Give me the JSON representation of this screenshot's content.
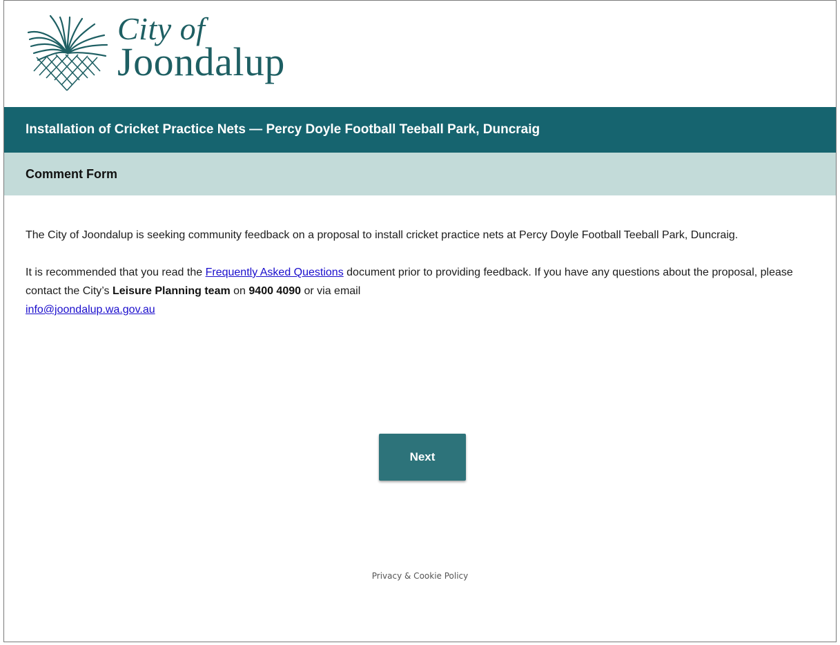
{
  "logo": {
    "icon": "joondalup-palm-lattice-logo",
    "line1": "City of",
    "line2": "Joondalup",
    "color": "#1e5f63"
  },
  "header": {
    "title": "Installation of Cricket Practice Nets — Percy Doyle Football Teeball Park, Duncraig",
    "background": "#16646f"
  },
  "subheader": {
    "title": "Comment Form",
    "background": "#c3dbd9"
  },
  "intro": {
    "paragraph1": "The City of Joondalup is seeking community feedback on a proposal to install cricket practice nets at Percy Doyle Football Teeball Park, Duncraig.",
    "p2_before": "It is recommended that you read the ",
    "faq_link": "Frequently Asked Questions",
    "p2_middle": " document prior to providing feedback. If you have any questions about the proposal, please contact the City’s ",
    "team": "Leisure Planning team",
    "p2_on": " on ",
    "phone": "9400 4090",
    "p2_email_prefix": " or via email ",
    "email": "info@joondalup.wa.gov.au"
  },
  "actions": {
    "next_label": "Next",
    "button_color": "#2d737a"
  },
  "footer": {
    "privacy_link": "Privacy & Cookie Policy"
  }
}
